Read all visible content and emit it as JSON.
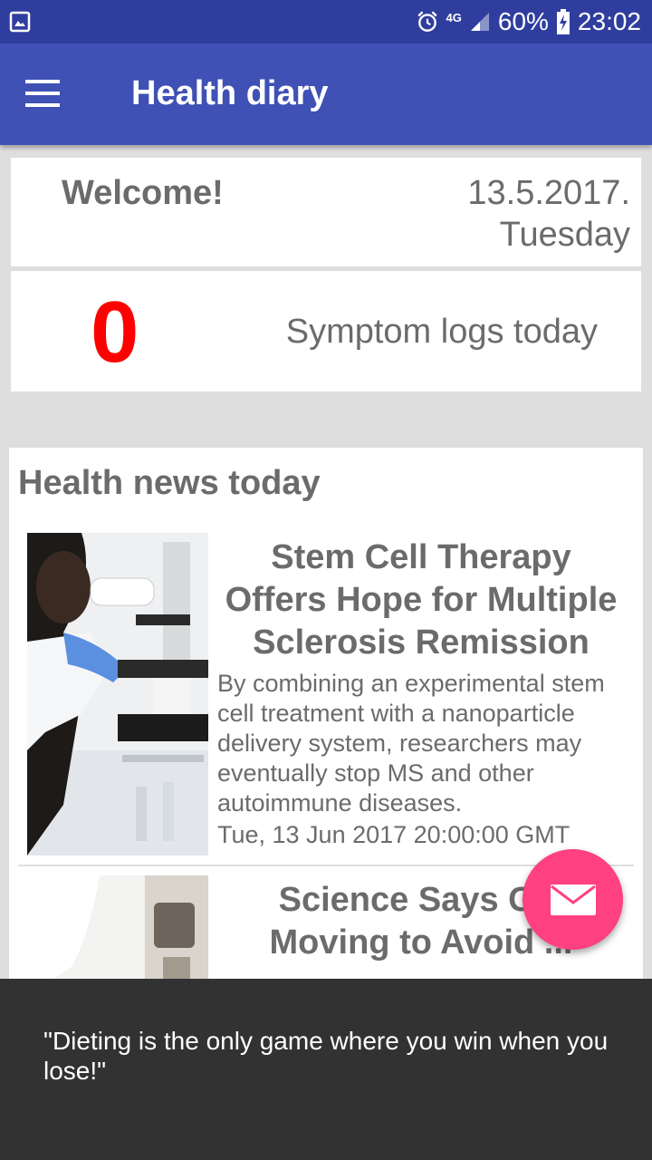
{
  "status_bar": {
    "network": "4G",
    "battery": "60%",
    "time": "23:02"
  },
  "app_bar": {
    "title": "Health diary"
  },
  "welcome": {
    "greeting": "Welcome!",
    "date": "13.5.2017.",
    "weekday": "Tuesday"
  },
  "symptoms": {
    "count": "0",
    "label": "Symptom logs today"
  },
  "news": {
    "heading": "Health news today",
    "items": [
      {
        "title": "Stem Cell Therapy Offers Hope for Multiple Sclerosis Remission",
        "description": "By combining an experimental stem cell treatment with a nanoparticle delivery system, researchers may eventually stop MS and other autoimmune diseases.",
        "date": "Tue, 13 Jun 2017 20:00:00 GMT"
      },
      {
        "title": "Science Says G... Moving to Avoid ..."
      }
    ]
  },
  "snackbar": {
    "quote": "\"Dieting is the only game where you win when you lose!\""
  },
  "colors": {
    "status_bar": "#2f3e9e",
    "app_bar": "#3f51b5",
    "fab": "#ff4081",
    "count": "#ff0000",
    "snackbar": "#323232"
  },
  "icons": {
    "menu": "hamburger-menu-icon",
    "fab": "envelope-icon",
    "status_image": "image-icon",
    "alarm": "alarm-icon",
    "signal": "signal-icon",
    "battery": "battery-charging-icon"
  }
}
